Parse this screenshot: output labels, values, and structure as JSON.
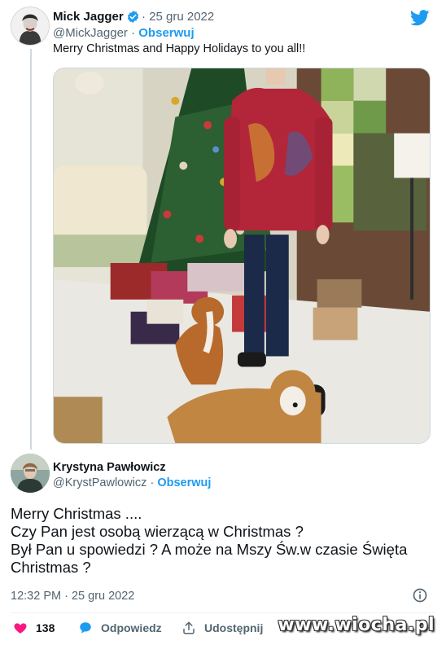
{
  "original_tweet": {
    "author_name": "Mick Jagger",
    "separator": " · ",
    "date": "25 gru 2022",
    "handle": "@MickJagger",
    "follow_separator": " · ",
    "follow_label": "Obserwuj",
    "text": "Merry Christmas and Happy Holidays to you all!!",
    "verified_icon": "verified-badge-icon",
    "platform_icon": "twitter-bird-icon"
  },
  "reply_tweet": {
    "author_name": "Krystyna Pawłowicz",
    "handle": "@KrystPawlowicz",
    "follow_separator": " · ",
    "follow_label": "Obserwuj",
    "text_lines": [
      "Merry Christmas ....",
      "Czy Pan jest osobą wierzącą w Christmas ?",
      "Był Pan u spowiedzi ? A może na Mszy Św.w czasie Święta",
      "Christmas ?"
    ],
    "time": "12:32 PM",
    "date_separator": " · ",
    "date": "25 gru 2022",
    "info_icon": "info-icon"
  },
  "actions": {
    "like_count": "138",
    "reply_label": "Odpowiedz",
    "share_label": "Udostępnij"
  },
  "watermark": "www.wiocha.pl",
  "colors": {
    "accent": "#1d9bf0",
    "like": "#f91880",
    "secondary_text": "#536471"
  }
}
